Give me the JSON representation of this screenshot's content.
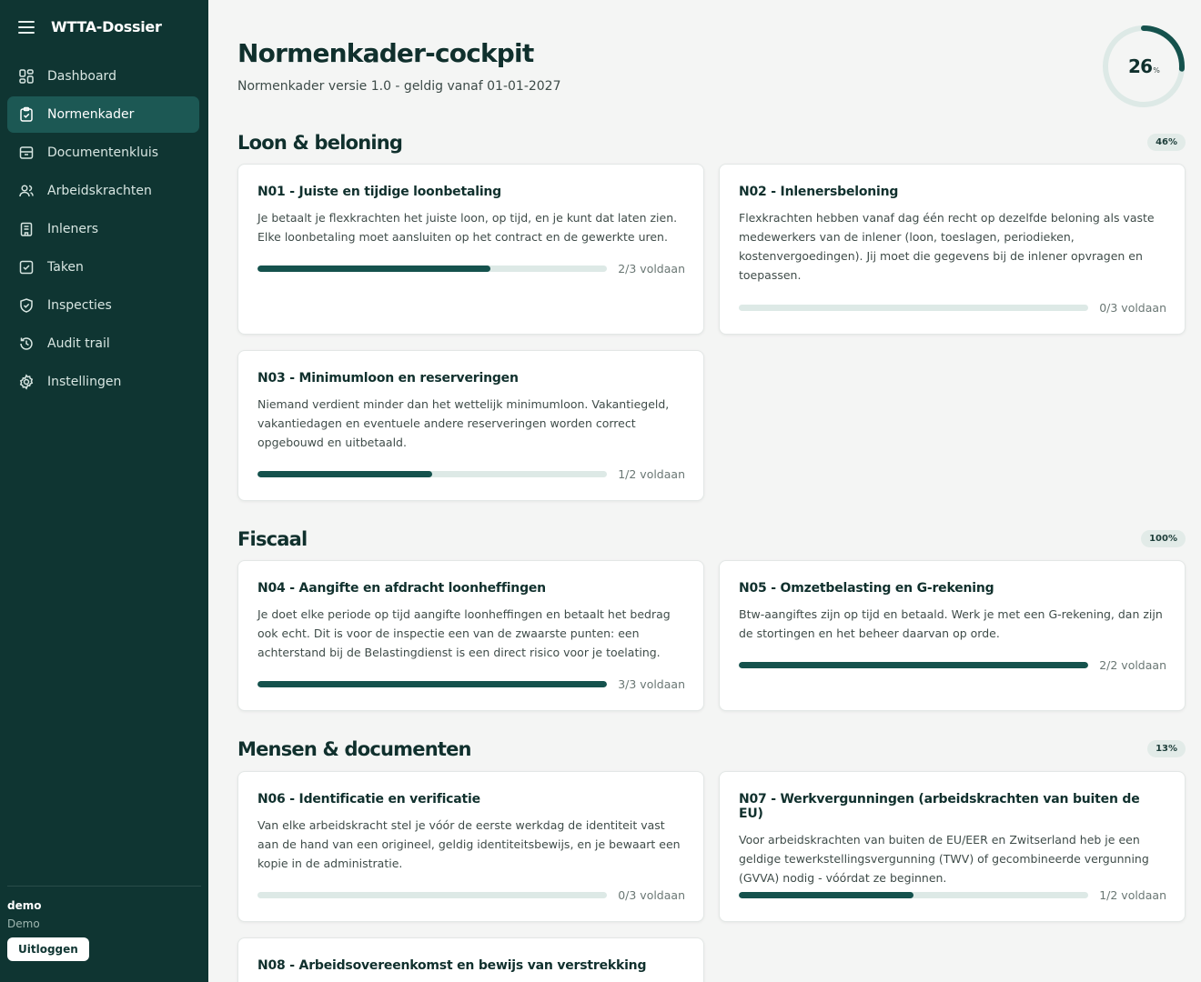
{
  "app": {
    "title": "WTTA-Dossier"
  },
  "nav": [
    {
      "label": "Dashboard",
      "icon": "dashboard-icon",
      "active": false
    },
    {
      "label": "Normenkader",
      "icon": "clipboard-check-icon",
      "active": true
    },
    {
      "label": "Documentenkluis",
      "icon": "archive-icon",
      "active": false
    },
    {
      "label": "Arbeidskrachten",
      "icon": "users-icon",
      "active": false
    },
    {
      "label": "Inleners",
      "icon": "building-icon",
      "active": false
    },
    {
      "label": "Taken",
      "icon": "checkbox-icon",
      "active": false
    },
    {
      "label": "Inspecties",
      "icon": "shield-check-icon",
      "active": false
    },
    {
      "label": "Audit trail",
      "icon": "history-icon",
      "active": false
    },
    {
      "label": "Instellingen",
      "icon": "gear-icon",
      "active": false
    }
  ],
  "user": {
    "name": "demo",
    "role": "Demo",
    "logout_label": "Uitloggen"
  },
  "header": {
    "title": "Normenkader-cockpit",
    "subtitle": "Normenkader versie 1.0 - geldig vanaf 01-01-2027",
    "overall_value": "26",
    "overall_unit": "%",
    "overall_fraction": 0.26
  },
  "colors": {
    "sidebar": "#0f3532",
    "active": "#1c5854",
    "progress": "#15524d",
    "track": "#dde9e6"
  },
  "sections": [
    {
      "title": "Loon & beloning",
      "pct": "46%",
      "cards": [
        {
          "title": "N01 - Juiste en tijdige loonbetaling",
          "desc": "Je betaalt je flexkrachten het juiste loon, op tijd, en je kunt dat laten zien. Elke loonbetaling moet aansluiten op het contract en de gewerkte uren.",
          "done": 2,
          "total": 3,
          "label": "2/3 voldaan"
        },
        {
          "title": "N02 - Inlenersbeloning",
          "desc": "Flexkrachten hebben vanaf dag één recht op dezelfde beloning als vaste medewerkers van de inlener (loon, toeslagen, periodieken, kostenvergoedingen). Jij moet die gegevens bij de inlener opvragen en toepassen.",
          "done": 0,
          "total": 3,
          "label": "0/3 voldaan"
        },
        {
          "title": "N03 - Minimumloon en reserveringen",
          "desc": "Niemand verdient minder dan het wettelijk minimumloon. Vakantiegeld, vakantiedagen en eventuele andere reserveringen worden correct opgebouwd en uitbetaald.",
          "done": 1,
          "total": 2,
          "label": "1/2 voldaan"
        }
      ]
    },
    {
      "title": "Fiscaal",
      "pct": "100%",
      "cards": [
        {
          "title": "N04 - Aangifte en afdracht loonheffingen",
          "desc": "Je doet elke periode op tijd aangifte loonheffingen en betaalt het bedrag ook echt. Dit is voor de inspectie een van de zwaarste punten: een achterstand bij de Belastingdienst is een direct risico voor je toelating.",
          "done": 3,
          "total": 3,
          "label": "3/3 voldaan"
        },
        {
          "title": "N05 - Omzetbelasting en G-rekening",
          "desc": "Btw-aangiftes zijn op tijd en betaald. Werk je met een G-rekening, dan zijn de stortingen en het beheer daarvan op orde.",
          "done": 2,
          "total": 2,
          "label": "2/2 voldaan"
        }
      ]
    },
    {
      "title": "Mensen & documenten",
      "pct": "13%",
      "cards": [
        {
          "title": "N06 - Identificatie en verificatie",
          "desc": "Van elke arbeidskracht stel je vóór de eerste werkdag de identiteit vast aan de hand van een origineel, geldig identiteitsbewijs, en je bewaart een kopie in de administratie.",
          "done": 0,
          "total": 3,
          "label": "0/3 voldaan"
        },
        {
          "title": "N07 - Werkvergunningen (arbeidskrachten van buiten de EU)",
          "desc": "Voor arbeidskrachten van buiten de EU/EER en Zwitserland heb je een geldige tewerkstellingsvergunning (TWV) of gecombineerde vergunning (GVVA) nodig - vóórdat ze beginnen.",
          "done": 1,
          "total": 2,
          "label": "1/2 voldaan"
        },
        {
          "title": "N08 - Arbeidsovereenkomst en bewijs van verstrekking"
        }
      ]
    }
  ]
}
